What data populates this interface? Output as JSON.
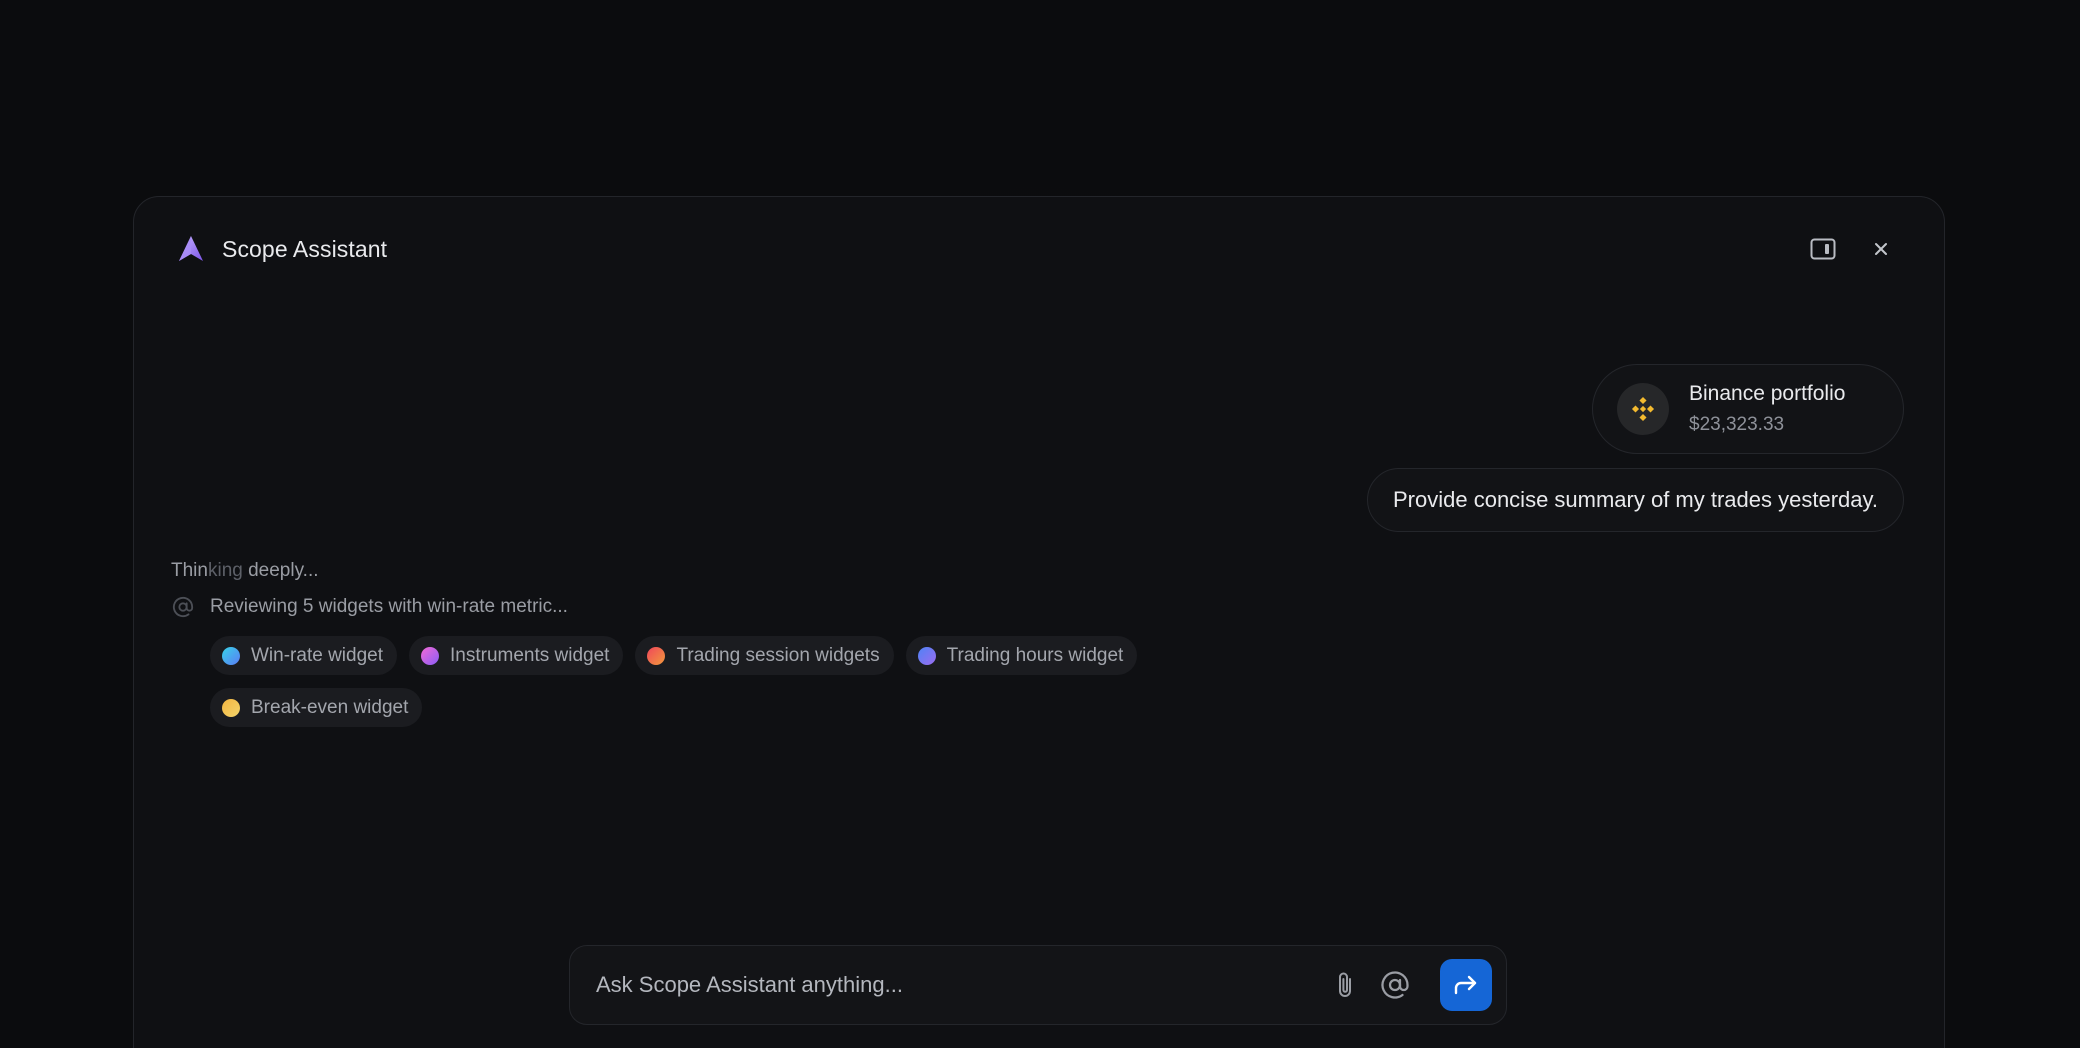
{
  "header": {
    "title": "Scope Assistant",
    "logo_icon": "scope-logo-icon",
    "actions": [
      {
        "name": "toggle-sidebar-panel",
        "icon": "panel-right-icon"
      },
      {
        "name": "close",
        "icon": "close-icon"
      }
    ]
  },
  "portfolio": {
    "name": "Binance portfolio",
    "value": "$23,323.33",
    "icon": "binance-icon",
    "accent": "#F3BA2F"
  },
  "user_message": "Provide concise summary of my trades yesterday.",
  "assistant": {
    "thinking_prefix": "Thin",
    "thinking_shine": "king",
    "thinking_suffix": " deeply...",
    "reviewing": "Reviewing 5 widgets with win-rate metric...",
    "widgets": [
      {
        "label": "Win-rate widget",
        "colors": [
          "#37d3e8",
          "#5b7cf5"
        ]
      },
      {
        "label": "Instruments widget",
        "colors": [
          "#f26ad6",
          "#8b5cf6"
        ]
      },
      {
        "label": "Trading session widgets",
        "colors": [
          "#f0465b",
          "#f29a3c"
        ]
      },
      {
        "label": "Trading hours widget",
        "colors": [
          "#4f83f5",
          "#9b6cf0"
        ]
      },
      {
        "label": "Break-even widget",
        "colors": [
          "#f3b541",
          "#f3d46b"
        ]
      }
    ]
  },
  "composer": {
    "placeholder": "Ask Scope Assistant anything...",
    "send_color": "#1566D6"
  }
}
